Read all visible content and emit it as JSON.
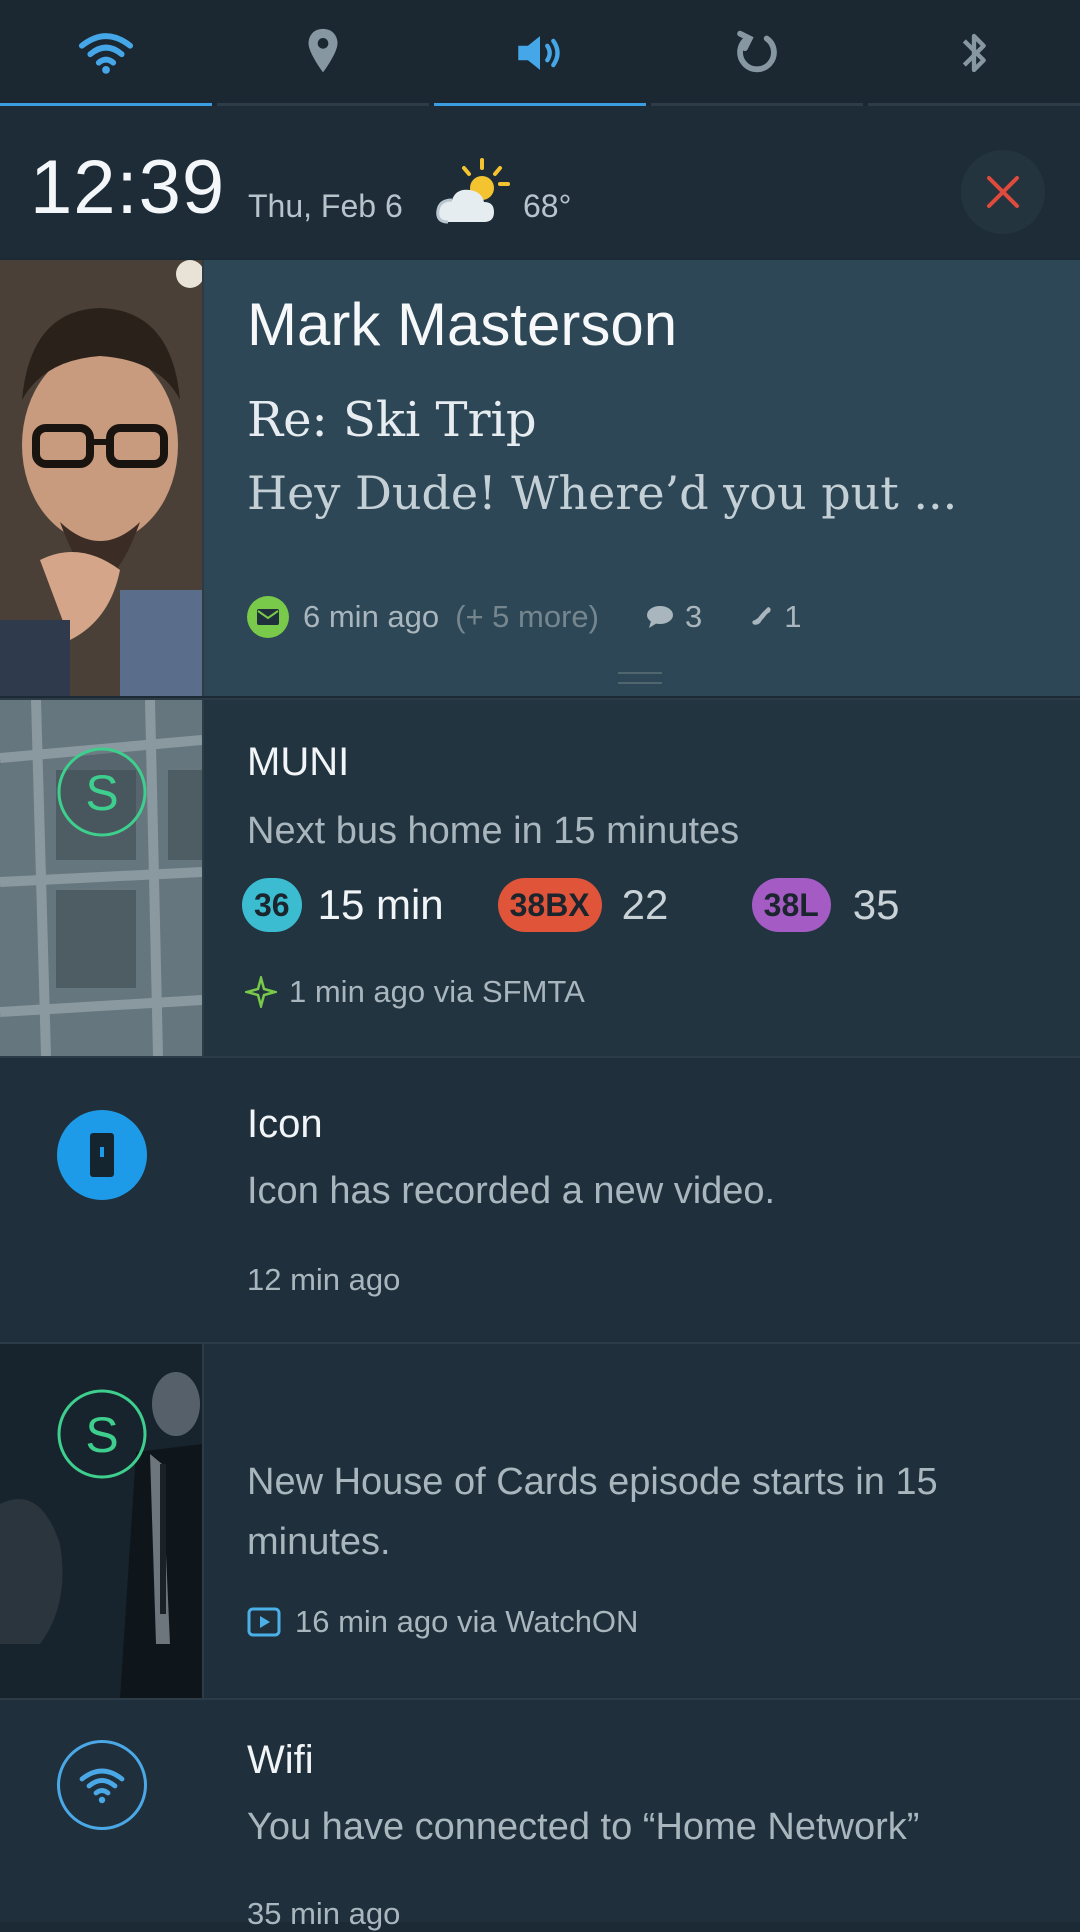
{
  "toggles": [
    {
      "name": "wifi-icon",
      "active": true
    },
    {
      "name": "location-icon",
      "active": false
    },
    {
      "name": "volume-icon",
      "active": true
    },
    {
      "name": "rotate-icon",
      "active": false
    },
    {
      "name": "bluetooth-icon",
      "active": false
    }
  ],
  "status": {
    "time": "12:39",
    "date": "Thu, Feb 6",
    "weather_icon": "partly-cloudy-icon",
    "temperature": "68°"
  },
  "notifications": {
    "email": {
      "sender": "Mark Masterson",
      "subject": "Re: Ski Trip",
      "preview": "Hey Dude! Where’d  you put ...",
      "time": "6 min ago",
      "more": "(+ 5 more)",
      "comments": "3",
      "calls": "1"
    },
    "muni": {
      "title": "MUNI",
      "body": "Next bus home in 15 minutes",
      "routes": [
        {
          "route": "36",
          "time": "15 min",
          "color": "#3cbcd0"
        },
        {
          "route": "38BX",
          "time": "22",
          "color": "#e0543a"
        },
        {
          "route": "38L",
          "time": "35",
          "color": "#a45cc4"
        }
      ],
      "meta": "1 min ago via SFMTA"
    },
    "icon": {
      "title": "Icon",
      "body": "Icon has recorded a new video.",
      "time": "12 min ago"
    },
    "watch": {
      "body": "New House of Cards episode starts in 15 minutes.",
      "meta": "16 min ago via WatchON"
    },
    "wifi": {
      "title": "Wifi",
      "body": "You have connected to “Home Network”",
      "time": "35 min ago"
    }
  },
  "colors": {
    "accent": "#3a9ee0",
    "email_green": "#79c94a",
    "s_green": "#3ecf8e"
  }
}
